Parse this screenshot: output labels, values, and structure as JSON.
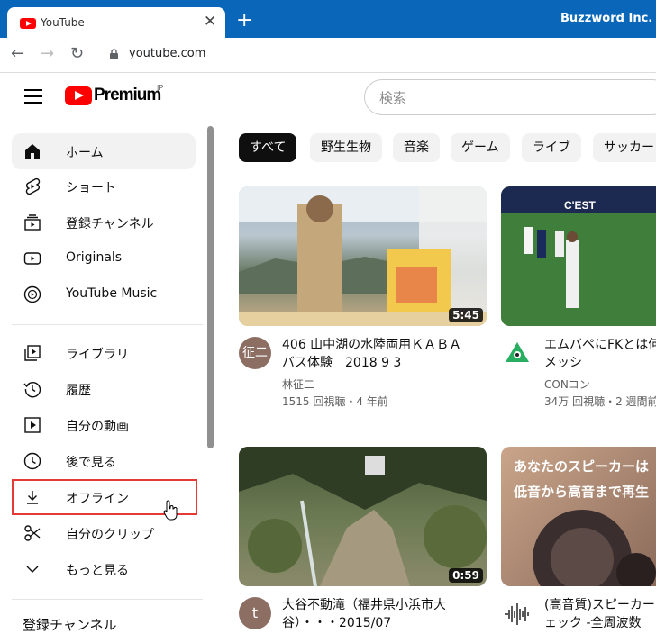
{
  "browser": {
    "tab_title": "YouTube",
    "tab_close": "✕",
    "new_tab": "+",
    "profile": "Buzzword Inc.",
    "back": "←",
    "forward": "→",
    "reload": "↻",
    "url": "youtube.com"
  },
  "header": {
    "logo_text": "Premium",
    "logo_region": "JP",
    "search_placeholder": "検索"
  },
  "sidebar": {
    "items": [
      {
        "label": "ホーム",
        "icon": "home-icon"
      },
      {
        "label": "ショート",
        "icon": "shorts-icon"
      },
      {
        "label": "登録チャンネル",
        "icon": "subscriptions-icon"
      },
      {
        "label": "Originals",
        "icon": "originals-icon"
      },
      {
        "label": "YouTube Music",
        "icon": "music-icon"
      },
      {
        "label": "ライブラリ",
        "icon": "library-icon"
      },
      {
        "label": "履歴",
        "icon": "history-icon"
      },
      {
        "label": "自分の動画",
        "icon": "my-videos-icon"
      },
      {
        "label": "後で見る",
        "icon": "watch-later-icon"
      },
      {
        "label": "オフライン",
        "icon": "download-icon"
      },
      {
        "label": "自分のクリップ",
        "icon": "clips-icon"
      },
      {
        "label": "もっと見る",
        "icon": "chevron-down-icon"
      }
    ],
    "section_title": "登録チャンネル"
  },
  "chips": [
    "すべて",
    "野生生物",
    "音楽",
    "ゲーム",
    "ライブ",
    "サッカー"
  ],
  "videos": [
    {
      "title": "406 山中湖の水陸両用ＫＡＢＡバス体験　2018 9 3",
      "channel": "林征二",
      "stats": "1515 回視聴・4 年前",
      "duration": "5:45",
      "avatar": "征二",
      "avatar_color": "#8d6e63"
    },
    {
      "title": "エムバペにFKとは何…メッシ",
      "channel": "CONコン",
      "stats": "34万 回視聴・2 週間前",
      "duration": "",
      "avatar": "",
      "avatar_color": "#ffffff"
    },
    {
      "title": "大谷不動滝（福井県小浜市大谷）・・・2015/07",
      "channel": "",
      "stats": "",
      "duration": "0:59",
      "avatar": "t",
      "avatar_color": "#8d6e63"
    },
    {
      "title": "(高音質)スピーカー…ェック -全周波数…",
      "channel": "",
      "stats": "",
      "duration": "",
      "avatar": "",
      "avatar_color": "#ffffff",
      "overlay_lines": [
        "あなたのスピーカーは",
        "低音から高音まで再生"
      ]
    }
  ],
  "colors": {
    "accent": "#ff0000",
    "highlight_box": "#e53935",
    "titlebar": "#0a66b8"
  }
}
